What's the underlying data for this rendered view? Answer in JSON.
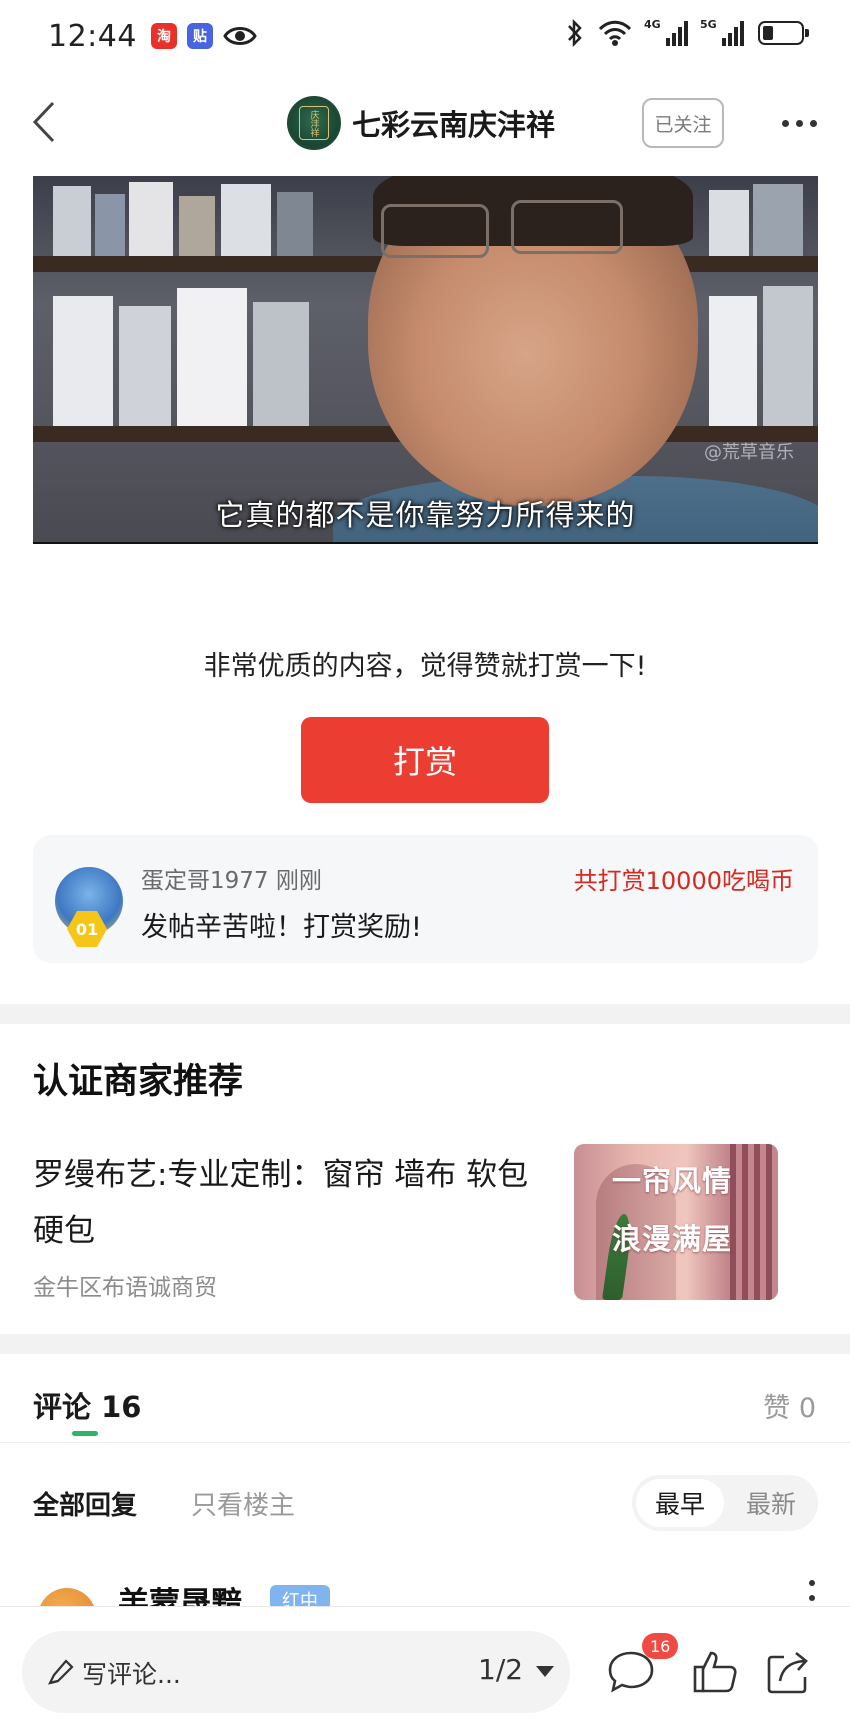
{
  "status_bar": {
    "time": "12:44",
    "app_icons": [
      "淘",
      "贴"
    ],
    "network": [
      "4G",
      "5G"
    ]
  },
  "nav": {
    "channel_name": "七彩云南庆沣祥",
    "avatar_text": "庆沣祥",
    "follow_label": "已关注"
  },
  "post": {
    "subtitle": "它真的都不是你靠努力所得来的",
    "watermark": "@荒草音乐"
  },
  "reward": {
    "prompt": "非常优质的内容，觉得赞就打赏一下!",
    "button_label": "打赏",
    "rank": "01",
    "rewarder": "蛋定哥1977 刚刚",
    "total": "共打赏10000吃喝币",
    "message": "发帖辛苦啦！打赏奖励!"
  },
  "merchant": {
    "heading": "认证商家推荐",
    "title": "罗缦布艺:专业定制：窗帘 墙布 软包硬包",
    "subtitle": "金牛区布语诚商贸",
    "thumb_line1": "一帘风情",
    "thumb_line2": "浪漫满屋"
  },
  "comments": {
    "tab_label": "评论",
    "count": "16",
    "likes": "赞 0",
    "filter_all": "全部回复",
    "filter_op": "只看楼主",
    "sort_earliest": "最早",
    "sort_newest": "最新",
    "first_user": "羔蒙晟黯",
    "first_badge": "红中"
  },
  "bottom_bar": {
    "placeholder": "写评论...",
    "page": "1/2",
    "comment_badge": "16"
  },
  "colors": {
    "accent_red": "#ec3d33",
    "reward_red": "#d8281f",
    "tab_green": "#2db46b"
  }
}
